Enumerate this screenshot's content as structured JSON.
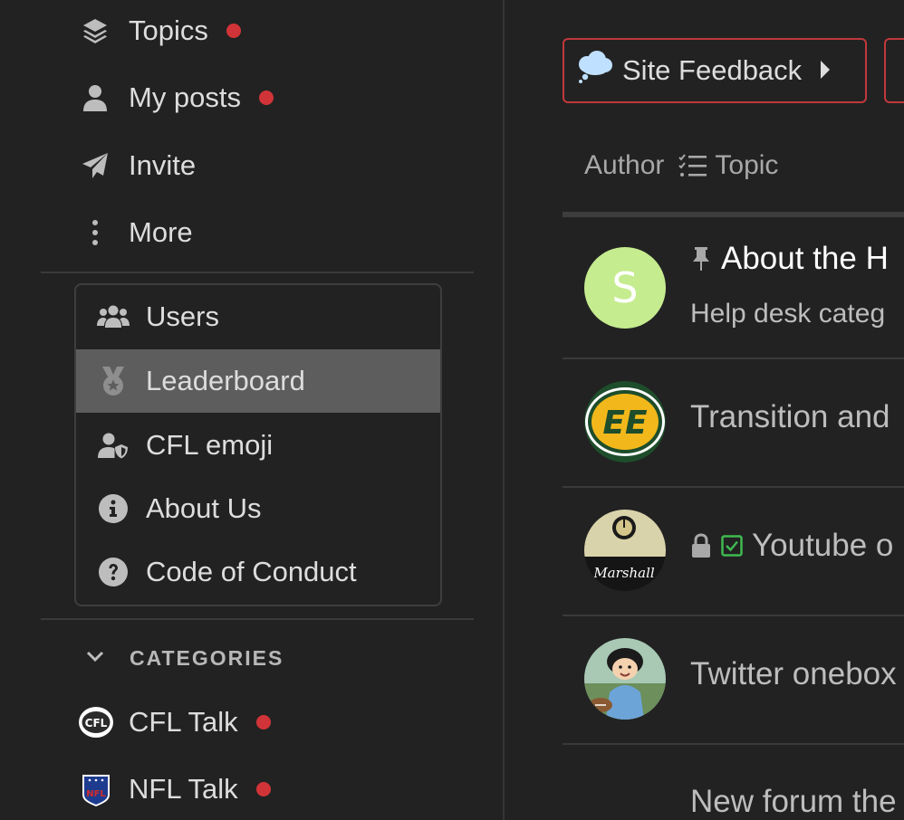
{
  "sidebar": {
    "nav": [
      {
        "label": "Topics",
        "icon": "layers-icon",
        "unread": true
      },
      {
        "label": "My posts",
        "icon": "user-icon",
        "unread": true
      },
      {
        "label": "Invite",
        "icon": "paper-plane-icon",
        "unread": false
      },
      {
        "label": "More",
        "icon": "ellipsis-vertical-icon",
        "unread": false
      }
    ],
    "more_menu": [
      {
        "label": "Users",
        "icon": "users-icon"
      },
      {
        "label": "Leaderboard",
        "icon": "medal-icon",
        "active": true
      },
      {
        "label": "CFL emoji",
        "icon": "user-shield-icon"
      },
      {
        "label": "About Us",
        "icon": "info-circle-icon"
      },
      {
        "label": "Code of Conduct",
        "icon": "question-circle-icon"
      }
    ],
    "categories_header": "CATEGORIES",
    "categories": [
      {
        "label": "CFL Talk",
        "logo_text": "CFL",
        "unread": true
      },
      {
        "label": "NFL Talk",
        "logo_text": "NFL",
        "unread": true
      }
    ]
  },
  "main": {
    "category_button": "Site Feedback",
    "columns": {
      "author": "Author",
      "topic": "Topic"
    },
    "topics": [
      {
        "title": "About the H",
        "excerpt": "Help desk categ",
        "avatar_letter": "S",
        "pinned": true
      },
      {
        "title": "Transition and",
        "avatar_text": "EE"
      },
      {
        "title": "Youtube o",
        "avatar_text": "Marshall",
        "locked": true,
        "solved": true
      },
      {
        "title": "Twitter onebox"
      },
      {
        "title": "New forum the"
      }
    ]
  },
  "colors": {
    "background": "#222222",
    "unread_dot": "#d13438",
    "category_border": "#c0383c",
    "active_menu": "#5d5d5d",
    "avatar_s": "#c5ec8f"
  }
}
